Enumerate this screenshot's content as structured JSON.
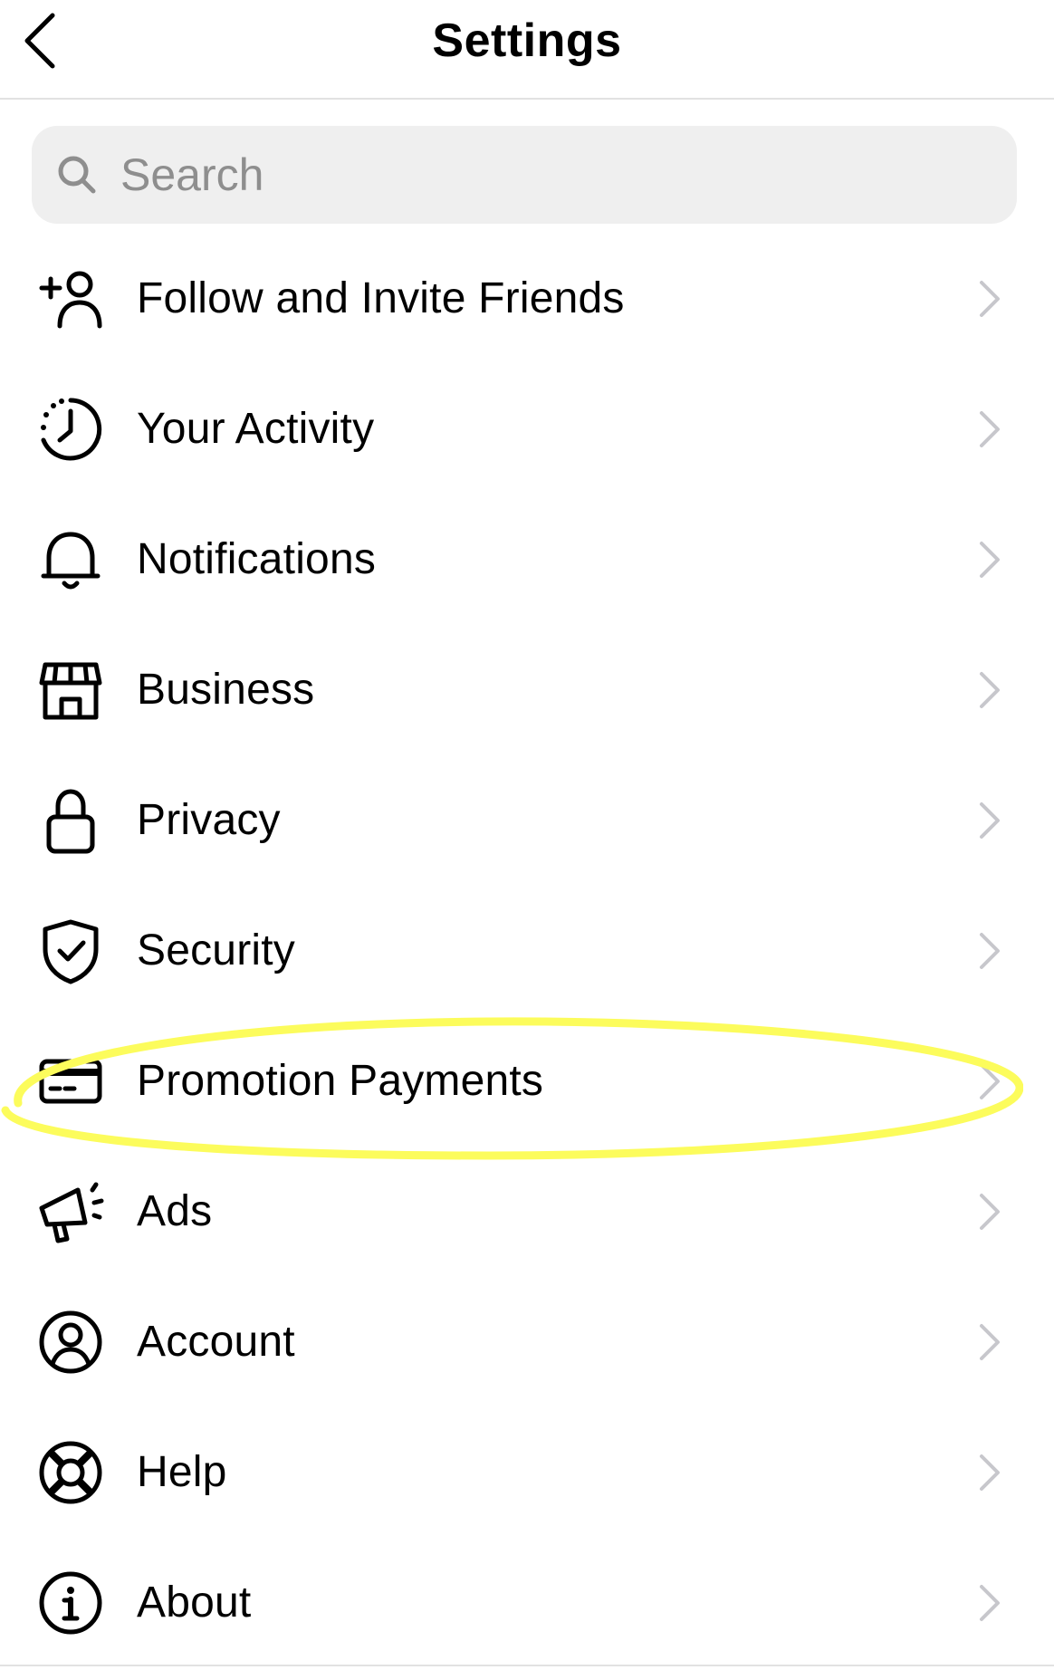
{
  "header": {
    "title": "Settings"
  },
  "search": {
    "placeholder": "Search",
    "value": ""
  },
  "menu": {
    "items": [
      {
        "label": "Follow and Invite Friends",
        "icon": "add-person-icon"
      },
      {
        "label": "Your Activity",
        "icon": "activity-clock-icon"
      },
      {
        "label": "Notifications",
        "icon": "bell-icon"
      },
      {
        "label": "Business",
        "icon": "storefront-icon"
      },
      {
        "label": "Privacy",
        "icon": "lock-icon"
      },
      {
        "label": "Security",
        "icon": "shield-check-icon"
      },
      {
        "label": "Promotion Payments",
        "icon": "credit-card-icon"
      },
      {
        "label": "Ads",
        "icon": "megaphone-icon"
      },
      {
        "label": "Account",
        "icon": "account-circle-icon"
      },
      {
        "label": "Help",
        "icon": "lifebuoy-icon"
      },
      {
        "label": "About",
        "icon": "info-icon"
      }
    ]
  },
  "highlight": {
    "color": "#fcfc5c",
    "target": "Promotion Payments"
  },
  "colors": {
    "chevron": "#c7c7cc",
    "divider": "#e2e2e2",
    "search_bg": "#efefef",
    "placeholder": "#8e8e8e"
  }
}
